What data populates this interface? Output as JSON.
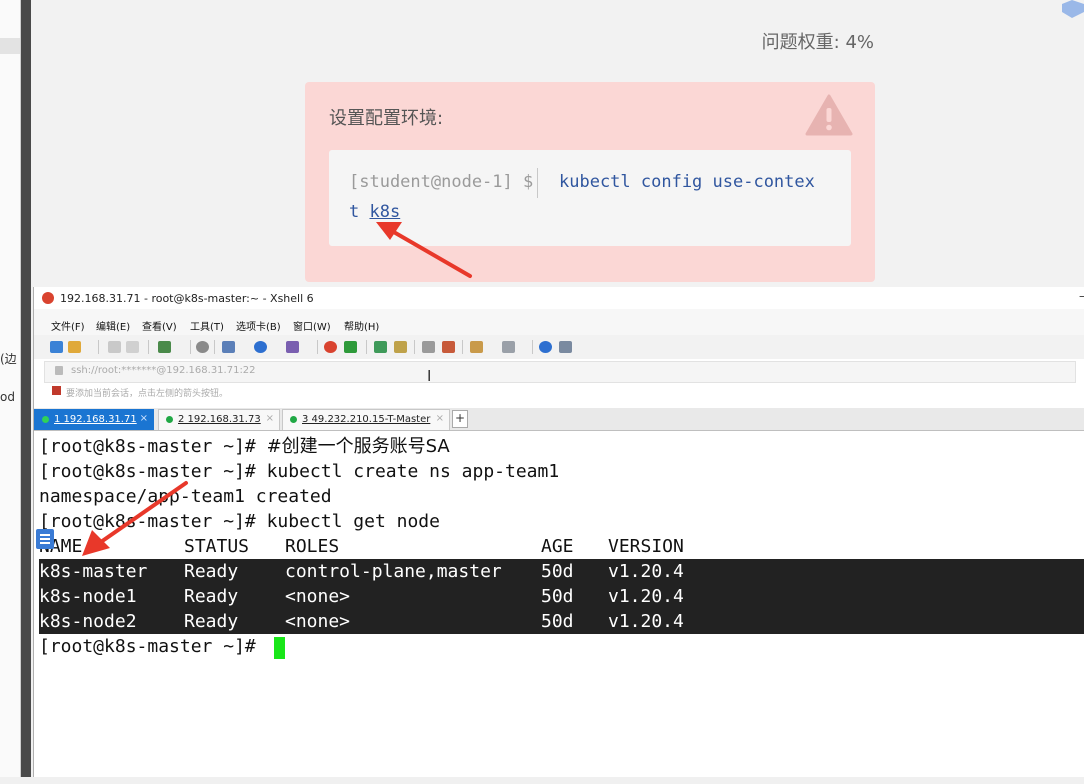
{
  "exam": {
    "weight_label": "问题权重: 4%",
    "setup_title": "设置配置环境:",
    "prompt": "[student@node-1] $",
    "command_line1": "kubectl config use-contex",
    "command_line2_prefix": "t ",
    "command_line2_highlight": "k8s"
  },
  "left_strip": {
    "frag1": "(边",
    "frag2": "od"
  },
  "xshell": {
    "title": "192.168.31.71 - root@k8s-master:~ - Xshell 6",
    "minimize": "–",
    "menu": [
      "文件(F)",
      "编辑(E)",
      "查看(V)",
      "工具(T)",
      "选项卡(B)",
      "窗口(W)",
      "帮助(H)"
    ],
    "address": "ssh://root:*******@192.168.31.71:22",
    "hint": "要添加当前会话，点击左侧的箭头按钮。",
    "tabs": [
      {
        "label": "1 192.168.31.71",
        "close": "×"
      },
      {
        "label": "2 192.168.31.73",
        "close": "×"
      },
      {
        "label": "3 49.232.210.15-T-Master",
        "close": "×"
      }
    ],
    "tab_add": "+",
    "terminal": {
      "line1_prompt": "[root@k8s-master ~]# ",
      "line1_comment": "#创建一个服务账号SA",
      "line2": "[root@k8s-master ~]# kubectl create ns app-team1",
      "line3": "namespace/app-team1 created",
      "line4": "[root@k8s-master ~]# kubectl get node",
      "headers": [
        "NAME",
        "STATUS",
        "ROLES",
        "AGE",
        "VERSION"
      ],
      "rows": [
        [
          "k8s-master",
          "Ready",
          "control-plane,master",
          "50d",
          "v1.20.4"
        ],
        [
          "k8s-node1",
          "Ready",
          "<none>",
          "50d",
          "v1.20.4"
        ],
        [
          "k8s-node2",
          "Ready",
          "<none>",
          "50d",
          "v1.20.4"
        ]
      ],
      "last_prompt": "[root@k8s-master ~]# "
    }
  },
  "colors": {
    "tab_active": "#1a75d2",
    "setup_box": "#fbd7d5",
    "command_text": "#30569f",
    "cursor": "#19e619",
    "arrow": "#e8382a"
  }
}
